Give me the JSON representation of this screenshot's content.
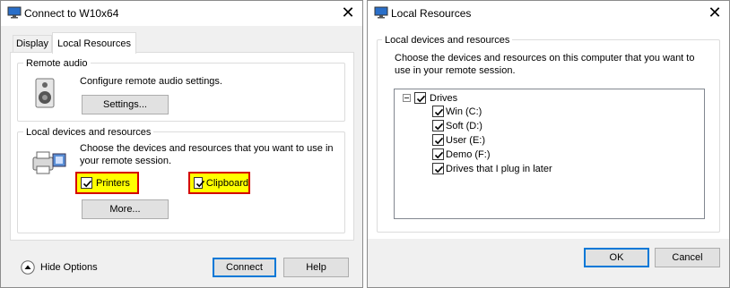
{
  "left_window": {
    "title": "Connect to W10x64",
    "close_glyph": "✕",
    "tabs": [
      {
        "label": "Display"
      },
      {
        "label": "Local Resources"
      }
    ],
    "remote_audio": {
      "group_label": "Remote audio",
      "description": "Configure remote audio settings.",
      "settings_button": "Settings..."
    },
    "local_devices": {
      "group_label": "Local devices and resources",
      "description_line1": "Choose the devices and resources that you want to use in",
      "description_line2": "your remote session.",
      "printers_label": "Printers",
      "clipboard_label": "Clipboard",
      "more_button": "More..."
    },
    "hide_options": "Hide Options",
    "connect_button": "Connect",
    "help_button": "Help"
  },
  "right_window": {
    "title": "Local Resources",
    "close_glyph": "✕",
    "group_label": "Local devices and resources",
    "description_line1": "Choose the devices and resources on this computer that you want to",
    "description_line2": "use in your remote session.",
    "tree": {
      "root_label": "Drives",
      "items": [
        {
          "label": "Win (C:)"
        },
        {
          "label": "Soft (D:)"
        },
        {
          "label": "User (E:)"
        },
        {
          "label": "Demo (F:)"
        },
        {
          "label": "Drives that I plug in later"
        }
      ]
    },
    "ok_button": "OK",
    "cancel_button": "Cancel"
  },
  "colors": {
    "highlight_fill": "#ffff00",
    "highlight_border": "#d40000",
    "default_button_border": "#0078d7"
  }
}
